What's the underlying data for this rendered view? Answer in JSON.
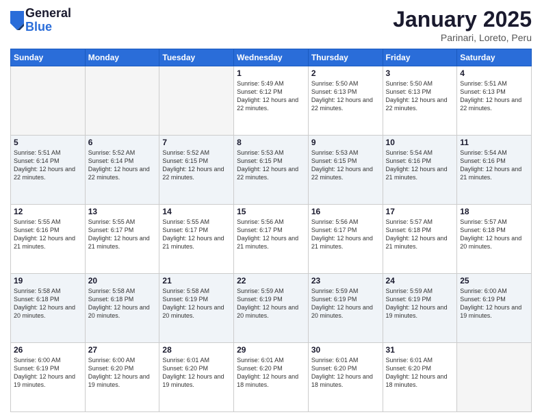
{
  "logo": {
    "general": "General",
    "blue": "Blue"
  },
  "header": {
    "title": "January 2025",
    "subtitle": "Parinari, Loreto, Peru"
  },
  "weekdays": [
    "Sunday",
    "Monday",
    "Tuesday",
    "Wednesday",
    "Thursday",
    "Friday",
    "Saturday"
  ],
  "weeks": [
    [
      {
        "day": "",
        "sunrise": "",
        "sunset": "",
        "daylight": ""
      },
      {
        "day": "",
        "sunrise": "",
        "sunset": "",
        "daylight": ""
      },
      {
        "day": "",
        "sunrise": "",
        "sunset": "",
        "daylight": ""
      },
      {
        "day": "1",
        "sunrise": "Sunrise: 5:49 AM",
        "sunset": "Sunset: 6:12 PM",
        "daylight": "Daylight: 12 hours and 22 minutes."
      },
      {
        "day": "2",
        "sunrise": "Sunrise: 5:50 AM",
        "sunset": "Sunset: 6:13 PM",
        "daylight": "Daylight: 12 hours and 22 minutes."
      },
      {
        "day": "3",
        "sunrise": "Sunrise: 5:50 AM",
        "sunset": "Sunset: 6:13 PM",
        "daylight": "Daylight: 12 hours and 22 minutes."
      },
      {
        "day": "4",
        "sunrise": "Sunrise: 5:51 AM",
        "sunset": "Sunset: 6:13 PM",
        "daylight": "Daylight: 12 hours and 22 minutes."
      }
    ],
    [
      {
        "day": "5",
        "sunrise": "Sunrise: 5:51 AM",
        "sunset": "Sunset: 6:14 PM",
        "daylight": "Daylight: 12 hours and 22 minutes."
      },
      {
        "day": "6",
        "sunrise": "Sunrise: 5:52 AM",
        "sunset": "Sunset: 6:14 PM",
        "daylight": "Daylight: 12 hours and 22 minutes."
      },
      {
        "day": "7",
        "sunrise": "Sunrise: 5:52 AM",
        "sunset": "Sunset: 6:15 PM",
        "daylight": "Daylight: 12 hours and 22 minutes."
      },
      {
        "day": "8",
        "sunrise": "Sunrise: 5:53 AM",
        "sunset": "Sunset: 6:15 PM",
        "daylight": "Daylight: 12 hours and 22 minutes."
      },
      {
        "day": "9",
        "sunrise": "Sunrise: 5:53 AM",
        "sunset": "Sunset: 6:15 PM",
        "daylight": "Daylight: 12 hours and 22 minutes."
      },
      {
        "day": "10",
        "sunrise": "Sunrise: 5:54 AM",
        "sunset": "Sunset: 6:16 PM",
        "daylight": "Daylight: 12 hours and 21 minutes."
      },
      {
        "day": "11",
        "sunrise": "Sunrise: 5:54 AM",
        "sunset": "Sunset: 6:16 PM",
        "daylight": "Daylight: 12 hours and 21 minutes."
      }
    ],
    [
      {
        "day": "12",
        "sunrise": "Sunrise: 5:55 AM",
        "sunset": "Sunset: 6:16 PM",
        "daylight": "Daylight: 12 hours and 21 minutes."
      },
      {
        "day": "13",
        "sunrise": "Sunrise: 5:55 AM",
        "sunset": "Sunset: 6:17 PM",
        "daylight": "Daylight: 12 hours and 21 minutes."
      },
      {
        "day": "14",
        "sunrise": "Sunrise: 5:55 AM",
        "sunset": "Sunset: 6:17 PM",
        "daylight": "Daylight: 12 hours and 21 minutes."
      },
      {
        "day": "15",
        "sunrise": "Sunrise: 5:56 AM",
        "sunset": "Sunset: 6:17 PM",
        "daylight": "Daylight: 12 hours and 21 minutes."
      },
      {
        "day": "16",
        "sunrise": "Sunrise: 5:56 AM",
        "sunset": "Sunset: 6:17 PM",
        "daylight": "Daylight: 12 hours and 21 minutes."
      },
      {
        "day": "17",
        "sunrise": "Sunrise: 5:57 AM",
        "sunset": "Sunset: 6:18 PM",
        "daylight": "Daylight: 12 hours and 21 minutes."
      },
      {
        "day": "18",
        "sunrise": "Sunrise: 5:57 AM",
        "sunset": "Sunset: 6:18 PM",
        "daylight": "Daylight: 12 hours and 20 minutes."
      }
    ],
    [
      {
        "day": "19",
        "sunrise": "Sunrise: 5:58 AM",
        "sunset": "Sunset: 6:18 PM",
        "daylight": "Daylight: 12 hours and 20 minutes."
      },
      {
        "day": "20",
        "sunrise": "Sunrise: 5:58 AM",
        "sunset": "Sunset: 6:18 PM",
        "daylight": "Daylight: 12 hours and 20 minutes."
      },
      {
        "day": "21",
        "sunrise": "Sunrise: 5:58 AM",
        "sunset": "Sunset: 6:19 PM",
        "daylight": "Daylight: 12 hours and 20 minutes."
      },
      {
        "day": "22",
        "sunrise": "Sunrise: 5:59 AM",
        "sunset": "Sunset: 6:19 PM",
        "daylight": "Daylight: 12 hours and 20 minutes."
      },
      {
        "day": "23",
        "sunrise": "Sunrise: 5:59 AM",
        "sunset": "Sunset: 6:19 PM",
        "daylight": "Daylight: 12 hours and 20 minutes."
      },
      {
        "day": "24",
        "sunrise": "Sunrise: 5:59 AM",
        "sunset": "Sunset: 6:19 PM",
        "daylight": "Daylight: 12 hours and 19 minutes."
      },
      {
        "day": "25",
        "sunrise": "Sunrise: 6:00 AM",
        "sunset": "Sunset: 6:19 PM",
        "daylight": "Daylight: 12 hours and 19 minutes."
      }
    ],
    [
      {
        "day": "26",
        "sunrise": "Sunrise: 6:00 AM",
        "sunset": "Sunset: 6:19 PM",
        "daylight": "Daylight: 12 hours and 19 minutes."
      },
      {
        "day": "27",
        "sunrise": "Sunrise: 6:00 AM",
        "sunset": "Sunset: 6:20 PM",
        "daylight": "Daylight: 12 hours and 19 minutes."
      },
      {
        "day": "28",
        "sunrise": "Sunrise: 6:01 AM",
        "sunset": "Sunset: 6:20 PM",
        "daylight": "Daylight: 12 hours and 19 minutes."
      },
      {
        "day": "29",
        "sunrise": "Sunrise: 6:01 AM",
        "sunset": "Sunset: 6:20 PM",
        "daylight": "Daylight: 12 hours and 18 minutes."
      },
      {
        "day": "30",
        "sunrise": "Sunrise: 6:01 AM",
        "sunset": "Sunset: 6:20 PM",
        "daylight": "Daylight: 12 hours and 18 minutes."
      },
      {
        "day": "31",
        "sunrise": "Sunrise: 6:01 AM",
        "sunset": "Sunset: 6:20 PM",
        "daylight": "Daylight: 12 hours and 18 minutes."
      },
      {
        "day": "",
        "sunrise": "",
        "sunset": "",
        "daylight": ""
      }
    ]
  ]
}
